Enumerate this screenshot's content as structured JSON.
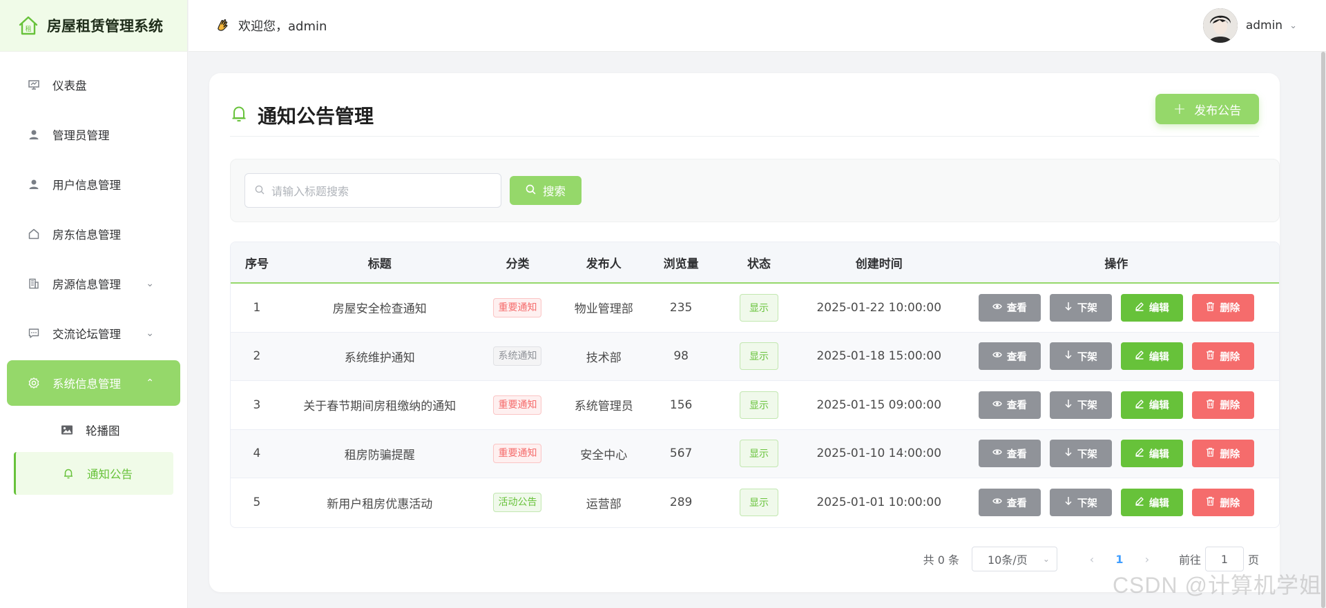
{
  "app": {
    "title": "房屋租赁管理系统"
  },
  "header": {
    "welcome": "欢迎您，admin",
    "user_name": "admin"
  },
  "sidebar": {
    "items": [
      {
        "label": "仪表盘",
        "icon": "dashboard-icon"
      },
      {
        "label": "管理员管理",
        "icon": "user-icon"
      },
      {
        "label": "用户信息管理",
        "icon": "user-icon"
      },
      {
        "label": "房东信息管理",
        "icon": "house-icon"
      },
      {
        "label": "房源信息管理",
        "icon": "building-icon",
        "expandable": true
      },
      {
        "label": "交流论坛管理",
        "icon": "chat-icon",
        "expandable": true
      },
      {
        "label": "系统信息管理",
        "icon": "gear-icon",
        "expandable": true,
        "active": true
      }
    ],
    "subitems": [
      {
        "label": "轮播图",
        "icon": "image-icon"
      },
      {
        "label": "通知公告",
        "icon": "bell-icon",
        "current": true
      }
    ]
  },
  "page": {
    "title": "通知公告管理",
    "publish_label": "发布公告"
  },
  "search": {
    "placeholder": "请输入标题搜索",
    "button_label": "搜索"
  },
  "table": {
    "columns": [
      "序号",
      "标题",
      "分类",
      "发布人",
      "浏览量",
      "状态",
      "创建时间",
      "操作"
    ],
    "rows": [
      {
        "idx": "1",
        "title": "房屋安全检查通知",
        "category": "重要通知",
        "category_color": "red",
        "publisher": "物业管理部",
        "views": "235",
        "status": "显示",
        "created": "2025-01-22 10:00:00"
      },
      {
        "idx": "2",
        "title": "系统维护通知",
        "category": "系统通知",
        "category_color": "gray",
        "publisher": "技术部",
        "views": "98",
        "status": "显示",
        "created": "2025-01-18 15:00:00"
      },
      {
        "idx": "3",
        "title": "关于春节期间房租缴纳的通知",
        "category": "重要通知",
        "category_color": "red",
        "publisher": "系统管理员",
        "views": "156",
        "status": "显示",
        "created": "2025-01-15 09:00:00"
      },
      {
        "idx": "4",
        "title": "租房防骗提醒",
        "category": "重要通知",
        "category_color": "red",
        "publisher": "安全中心",
        "views": "567",
        "status": "显示",
        "created": "2025-01-10 14:00:00"
      },
      {
        "idx": "5",
        "title": "新用户租房优惠活动",
        "category": "活动公告",
        "category_color": "green",
        "publisher": "运营部",
        "views": "289",
        "status": "显示",
        "created": "2025-01-01 10:00:00"
      }
    ],
    "ops": {
      "view": "查看",
      "down": "下架",
      "edit": "编辑",
      "delete": "删除"
    }
  },
  "pagination": {
    "total": "共 0 条",
    "page_size": "10条/页",
    "current_page": "1",
    "goto_prefix": "前往",
    "goto_value": "1",
    "goto_suffix": "页"
  },
  "watermark": "CSDN @计算机学姐",
  "colors": {
    "accent": "#95d86a",
    "success": "#67c23a",
    "danger": "#f56c6c",
    "info": "#909399"
  }
}
